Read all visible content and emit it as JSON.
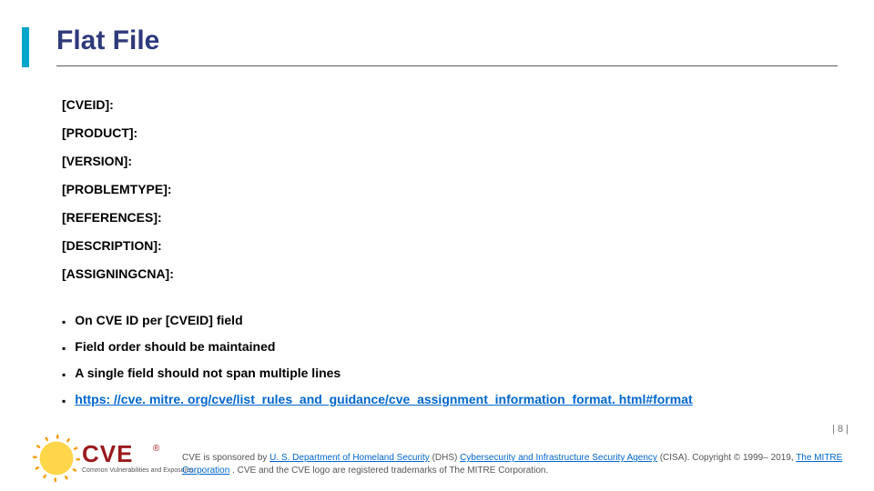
{
  "title": "Flat File",
  "fields": [
    "[CVEID]:",
    "[PRODUCT]:",
    "[VERSION]:",
    "[PROBLEMTYPE]:",
    "[REFERENCES]:",
    "[DESCRIPTION]:",
    "[ASSIGNINGCNA]:"
  ],
  "bullets": [
    {
      "text": "On CVE ID per [CVEID] field",
      "link": false
    },
    {
      "text": "Field order should be maintained",
      "link": false
    },
    {
      "text": "A single field should not span multiple lines",
      "link": false
    },
    {
      "text": "https: //cve. mitre. org/cve/list_rules_and_guidance/cve_assignment_information_format. html#format",
      "link": true
    }
  ],
  "page_number": "| 8 |",
  "footer": {
    "prefix": "CVE is sponsored by ",
    "link1": "U. S. Department of Homeland Security",
    "mid1": " (DHS) ",
    "link2": "Cybersecurity and Infrastructure Security Agency",
    "mid2": " (CISA). Copyright © 1999– 2019, ",
    "link3": "The MITRE Corporation",
    "suffix": ". CVE and the CVE logo are registered trademarks of The MITRE Corporation."
  },
  "logo": {
    "text": "CVE",
    "reg": "®",
    "tagline": "Common Vulnerabilities and Exposures"
  }
}
